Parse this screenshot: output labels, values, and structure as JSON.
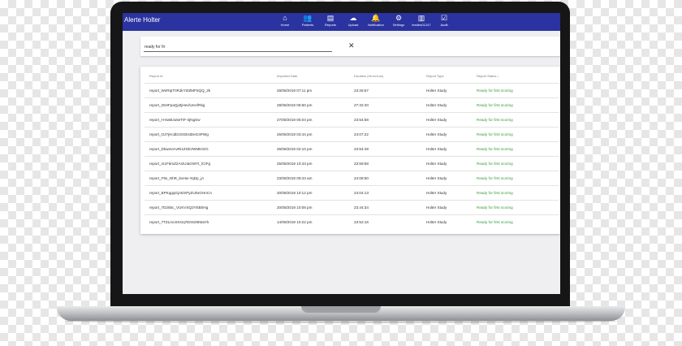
{
  "app": {
    "title": "Alerte Holter"
  },
  "nav": [
    {
      "label": "Home",
      "icon": "home-icon",
      "glyph": "⌂"
    },
    {
      "label": "Patients",
      "icon": "patients-icon",
      "glyph": "👥"
    },
    {
      "label": "Reports",
      "icon": "reports-icon",
      "glyph": "▤"
    },
    {
      "label": "Upload",
      "icon": "upload-icon",
      "glyph": "☁"
    },
    {
      "label": "Notification",
      "icon": "bell-icon",
      "glyph": "🔔"
    },
    {
      "label": "Settings",
      "icon": "gear-icon",
      "glyph": "⚙"
    },
    {
      "label": "testdrs01247",
      "icon": "stats-icon",
      "glyph": "▥"
    },
    {
      "label": "Audit",
      "icon": "audit-icon",
      "glyph": "☑"
    }
  ],
  "search": {
    "value": "ready for fir",
    "clear_glyph": "✕"
  },
  "table": {
    "headers": [
      "Report Id",
      "Imported Date",
      "Duration (hh:mm:ss)",
      "Report Type",
      "Report Status"
    ],
    "sort_glyph": "↓",
    "rows": [
      [
        "report_WsRIpT0RJkYt0ZMF5QQ_2k",
        "28/08/2019 07:11 pm",
        "23:26:57",
        "Holter Study",
        "Ready for first scoring"
      ],
      [
        "report_25HFpaQj4tjHevhJeAfRkg",
        "28/08/2019 06:50 pm",
        "27:32:40",
        "Holter Study",
        "Ready for first scoring"
      ],
      [
        "report_H-6aMJu5eTtF-irjNgSw",
        "27/08/2019 05:04 pm",
        "23:54:58",
        "Holter Study",
        "Ready for first scoring"
      ],
      [
        "report_OJ7jHcdDzSGEsiDeG4PWg",
        "26/08/2019 03:44 pm",
        "24:07:22",
        "Holter Study",
        "Ready for first scoring"
      ],
      [
        "report_DkwevIAvRi1ZSkVWMK0zG",
        "26/08/2019 02:10 pm",
        "23:54:49",
        "Holter Study",
        "Ready for first scoring"
      ],
      [
        "report_m1F5mZ2AIzUIaGWYt_lCIFg",
        "25/08/2019 10:43 pm",
        "23:59:58",
        "Holter Study",
        "Ready for first scoring"
      ],
      [
        "report_F9x_NhR_bxHw-YqDp_jA",
        "23/08/2019 09:43 am",
        "24:08:50",
        "Holter Study",
        "Ready for first scoring"
      ],
      [
        "report_BPKqgqGjAESPyZUksGHnCA",
        "20/08/2019 10:12 pm",
        "24:04:13",
        "Holter Study",
        "Ready for first scoring"
      ],
      [
        "report_7D255c_VUKVSQ3YEB0Hg",
        "20/08/2019 10:08 pm",
        "23:44:34",
        "Holter Study",
        "Ready for first scoring"
      ],
      [
        "report_7TZLmcSKOq7E0S29IWaYk",
        "14/08/2019 10:22 pm",
        "23:52:16",
        "Holter Study",
        "Ready for first scoring"
      ]
    ]
  },
  "colors": {
    "appbar": "#2a33a0",
    "status_green": "#3a9a3a"
  }
}
